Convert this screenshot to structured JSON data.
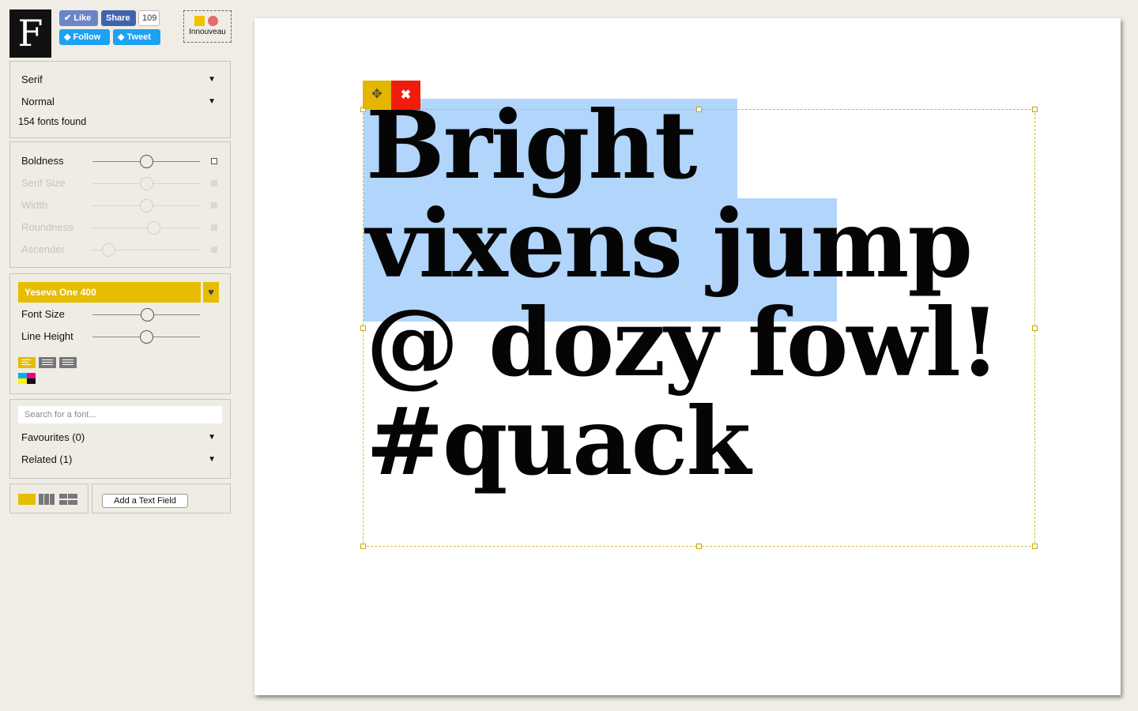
{
  "header": {
    "logo": "F",
    "social": {
      "like": "✔ Like",
      "share": "Share",
      "share_count": "109",
      "follow": "Follow",
      "tweet": "Tweet"
    },
    "partner": {
      "label": "Innouveau"
    }
  },
  "filters": {
    "category": "Serif",
    "style": "Normal",
    "count": "154 fonts found"
  },
  "sliders": [
    {
      "label": "Boldness",
      "value": 0.5,
      "enabled": true
    },
    {
      "label": "Serif Size",
      "value": 0.5,
      "enabled": false
    },
    {
      "label": "Width",
      "value": 0.5,
      "enabled": false
    },
    {
      "label": "Roundness",
      "value": 0.57,
      "enabled": false
    },
    {
      "label": "Ascender",
      "value": 0.15,
      "enabled": false
    }
  ],
  "font": {
    "name": "Yeseva One 400",
    "fav_icon": "♥",
    "size_label": "Font Size",
    "size_value": 0.51,
    "lineheight_label": "Line Height",
    "lineheight_value": 0.5,
    "align": [
      "align-left-icon",
      "align-center-icon",
      "align-right-icon"
    ]
  },
  "search": {
    "placeholder": "Search for a font...",
    "favourites": "Favourites (0)",
    "related": "Related (1)"
  },
  "bottom": {
    "add_field": "Add a Text Field"
  },
  "canvas": {
    "lines": [
      "Bright",
      "vixens jump",
      "@ dozy fowl!",
      "#quack"
    ],
    "move_icon": "✥",
    "close_icon": "✖"
  },
  "colors": {
    "accent": "#e6bd00",
    "close": "#f01c0c",
    "selection": "#b2d5fb"
  }
}
